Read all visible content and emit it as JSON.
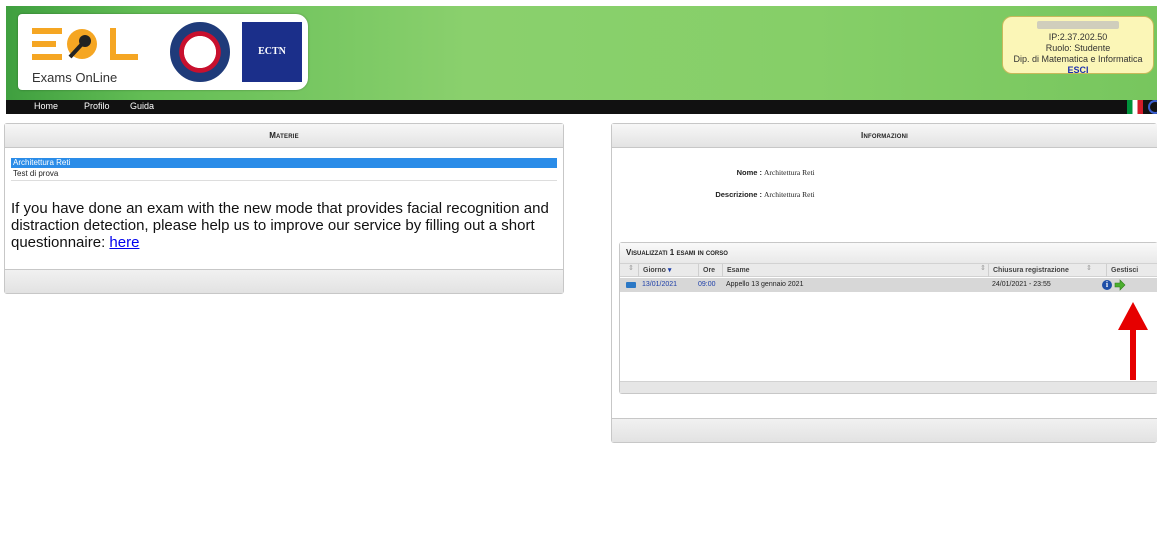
{
  "header": {
    "logo_tagline": "Exams OnLine",
    "ectn_label": "ECTN",
    "user": {
      "ip": "IP:2.37.202.50",
      "role": "Ruolo: Studente",
      "department": "Dip. di Matematica e Informatica",
      "logout": "ESCI"
    }
  },
  "menu": {
    "home": "Home",
    "profile": "Profilo",
    "guide": "Guida"
  },
  "subjects": {
    "title": "Materie",
    "items": [
      "Architettura Reti",
      "Test di prova"
    ],
    "notice_text": "If you have done an exam with the new mode that provides facial recognition and distraction detection, please help us to improve our service by filling out a short questionnaire: ",
    "notice_link": "here"
  },
  "info": {
    "title": "Informazioni",
    "name_label": "Nome :",
    "name_value": "Architettura Reti",
    "desc_label": "Descrizione :",
    "desc_value": "Architettura Reti",
    "grid": {
      "caption": "Visualizzati 1 esami in corso",
      "columns": {
        "day": "Giorno",
        "time": "Ore",
        "exam": "Esame",
        "closing": "Chiusura registrazione",
        "manage": "Gestisci"
      },
      "rows": [
        {
          "day": "13/01/2021",
          "time": "09:00",
          "exam": "Appello 13 gennaio 2021",
          "closing": "24/01/2021 - 23:55"
        }
      ]
    }
  },
  "colors": {
    "header_green": "#86cf68",
    "selection_blue": "#2a8ce8",
    "annotation_red": "#e60000"
  }
}
